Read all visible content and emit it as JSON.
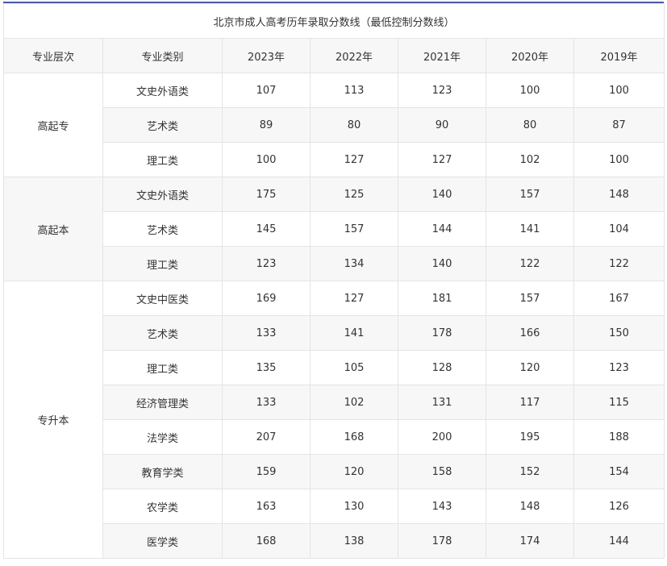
{
  "title": "北京市成人高考历年录取分数线（最低控制分数线）",
  "headers": [
    "专业层次",
    "专业类别",
    "2023年",
    "2022年",
    "2021年",
    "2020年",
    "2019年"
  ],
  "groups": [
    {
      "level": "高起专",
      "rows": [
        {
          "category": "文史外语类",
          "values": [
            "107",
            "113",
            "123",
            "100",
            "100"
          ]
        },
        {
          "category": "艺术类",
          "values": [
            "89",
            "80",
            "90",
            "80",
            "87"
          ]
        },
        {
          "category": "理工类",
          "values": [
            "100",
            "127",
            "127",
            "102",
            "100"
          ]
        }
      ]
    },
    {
      "level": "高起本",
      "rows": [
        {
          "category": "文史外语类",
          "values": [
            "175",
            "125",
            "140",
            "157",
            "148"
          ]
        },
        {
          "category": "艺术类",
          "values": [
            "145",
            "157",
            "144",
            "141",
            "104"
          ]
        },
        {
          "category": "理工类",
          "values": [
            "123",
            "134",
            "140",
            "122",
            "122"
          ]
        }
      ]
    },
    {
      "level": "专升本",
      "rows": [
        {
          "category": "文史中医类",
          "values": [
            "169",
            "127",
            "181",
            "157",
            "167"
          ]
        },
        {
          "category": "艺术类",
          "values": [
            "133",
            "141",
            "178",
            "166",
            "150"
          ]
        },
        {
          "category": "理工类",
          "values": [
            "135",
            "105",
            "128",
            "120",
            "123"
          ]
        },
        {
          "category": "经济管理类",
          "values": [
            "133",
            "102",
            "131",
            "117",
            "115"
          ]
        },
        {
          "category": "法学类",
          "values": [
            "207",
            "168",
            "200",
            "195",
            "188"
          ]
        },
        {
          "category": "教育学类",
          "values": [
            "159",
            "120",
            "158",
            "152",
            "154"
          ]
        },
        {
          "category": "农学类",
          "values": [
            "163",
            "130",
            "143",
            "148",
            "126"
          ]
        },
        {
          "category": "医学类",
          "values": [
            "168",
            "138",
            "178",
            "174",
            "144"
          ]
        }
      ]
    }
  ]
}
